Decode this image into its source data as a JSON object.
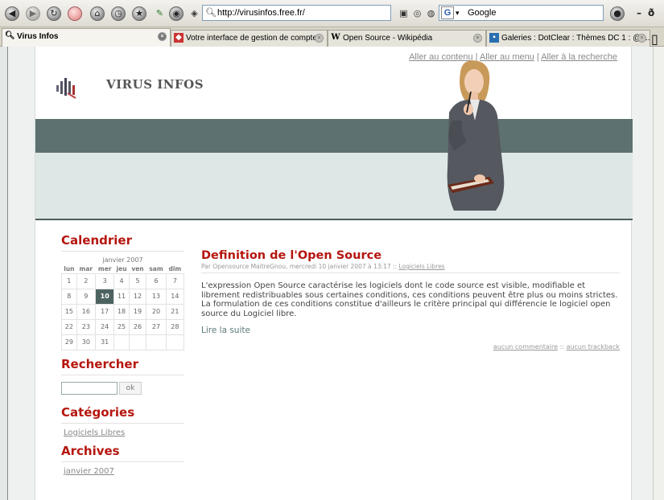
{
  "browser": {
    "url": "http://virusinfos.free.fr/",
    "search_engine_label": "Google",
    "tabs": [
      {
        "label": "Virus Infos",
        "active": true
      },
      {
        "label": "Votre interface de gestion de comptes",
        "active": false
      },
      {
        "label": "Open Source - Wikipédia",
        "active": false
      },
      {
        "label": "Galeries : DotClear : Thèmes DC 1 : @t...",
        "active": false
      }
    ],
    "win_min": "–",
    "win_max": "ð"
  },
  "header": {
    "skip_content": "Aller au contenu",
    "skip_menu": "Aller au menu",
    "skip_search": "Aller à la recherche",
    "separator": "|",
    "site_title": "VIRUS INFOS"
  },
  "sidebar": {
    "calendar_heading": "Calendrier",
    "calendar_caption": "janvier 2007",
    "weekdays": [
      "lun",
      "mar",
      "mer",
      "jeu",
      "ven",
      "sam",
      "dim"
    ],
    "weeks": [
      [
        "1",
        "2",
        "3",
        "4",
        "5",
        "6",
        "7"
      ],
      [
        "8",
        "9",
        "10",
        "11",
        "12",
        "13",
        "14"
      ],
      [
        "15",
        "16",
        "17",
        "18",
        "19",
        "20",
        "21"
      ],
      [
        "22",
        "23",
        "24",
        "25",
        "26",
        "27",
        "28"
      ],
      [
        "29",
        "30",
        "31",
        "",
        "",
        "",
        ""
      ]
    ],
    "today": "10",
    "search_heading": "Rechercher",
    "search_button": "ok",
    "categories_heading": "Catégories",
    "category_link": "Logiciels Libres",
    "archives_heading": "Archives",
    "archive_link": "janvier 2007"
  },
  "post": {
    "title": "Definition de l'Open Source",
    "meta_prefix": "Par Opensource MaitreGnou, mercredi 10 janvier 2007 à 13:17 :: ",
    "meta_category": "Logiciels Libres",
    "body": "L'expression Open Source caractérise les logiciels dont le code source est visible, modifiable et librement redistribuables sous certaines conditions, ces conditions peuvent être plus ou moins strictes. La formulation de ces conditions constitue d'ailleurs le critère principal qui différencie le logiciel open source du Logiciel libre.",
    "read_more": "Lire la suite",
    "comments": "aucun commentaire",
    "foot_sep": " :: ",
    "trackbacks": "aucun trackback"
  }
}
